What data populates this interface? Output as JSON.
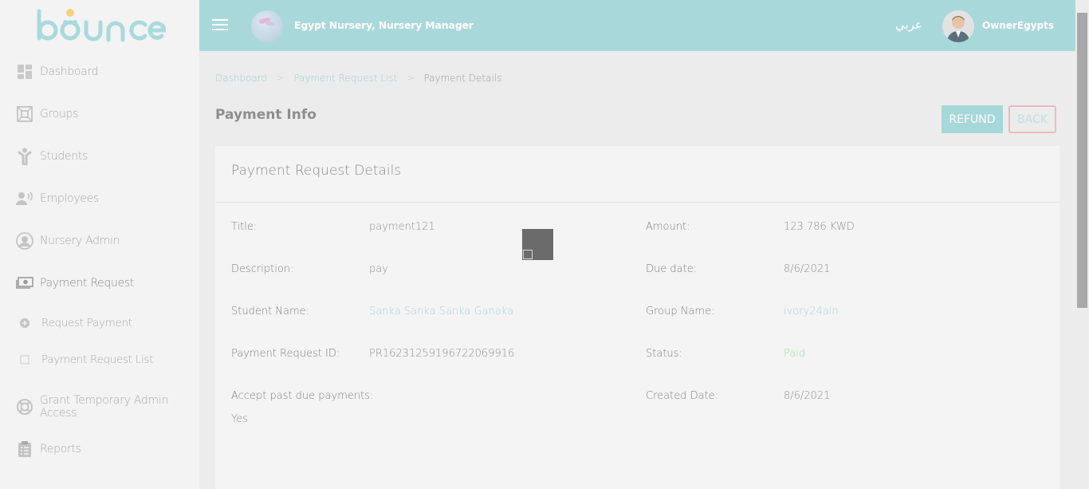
{
  "brand": {
    "logo_text": "bounce"
  },
  "sidebar": {
    "items": [
      {
        "label": "Dashboard",
        "icon": "dashboard-icon"
      },
      {
        "label": "Groups",
        "icon": "groups-icon"
      },
      {
        "label": "Students",
        "icon": "student-icon"
      },
      {
        "label": "Employees",
        "icon": "employees-icon"
      },
      {
        "label": "Nursery Admin",
        "icon": "user-circle-icon"
      },
      {
        "label": "Payment Request",
        "icon": "money-icon"
      },
      {
        "label": "Request Payment",
        "icon": "plus-circle-icon"
      },
      {
        "label": "Payment Request List",
        "icon": "square-icon"
      },
      {
        "label": "Grant Temporary Admin Access",
        "icon": "lifebuoy-icon"
      },
      {
        "label": "Reports",
        "icon": "clipboard-icon"
      }
    ]
  },
  "header": {
    "nursery_title": "Egypt Nursery, Nursery Manager",
    "language_toggle": "عربي",
    "user_name": "OwnerEgypts"
  },
  "breadcrumb": [
    "Dashboard",
    "Payment Request List",
    "Payment Details"
  ],
  "page": {
    "title": "Payment Info",
    "refund_label": "REFUND",
    "back_label": "BACK"
  },
  "card": {
    "title": "Payment Request Details",
    "fields": {
      "title_label": "Title:",
      "title_value": "payment121",
      "amount_label": "Amount:",
      "amount_value": "123.786 KWD",
      "description_label": "Description:",
      "description_value": "pay",
      "due_label": "Due date:",
      "due_value": "8/6/2021",
      "student_label": "Student Name:",
      "student_value": "Sanka Sanka Sanka Ganaka",
      "group_label": "Group Name:",
      "group_value": "ivory24aln",
      "request_id_label": "Payment Request ID:",
      "request_id_value": "PR16231259196722069916",
      "status_label": "Status:",
      "status_value": "Paid",
      "past_due_label": "Accept past due payments:",
      "past_due_value": "Yes",
      "created_label": "Created Date:",
      "created_value": "8/6/2021"
    }
  },
  "colors": {
    "accent": "#a9d8da",
    "link": "#9fd3d6",
    "status_paid": "#9fd89f",
    "back_border": "#e7b9c3"
  }
}
